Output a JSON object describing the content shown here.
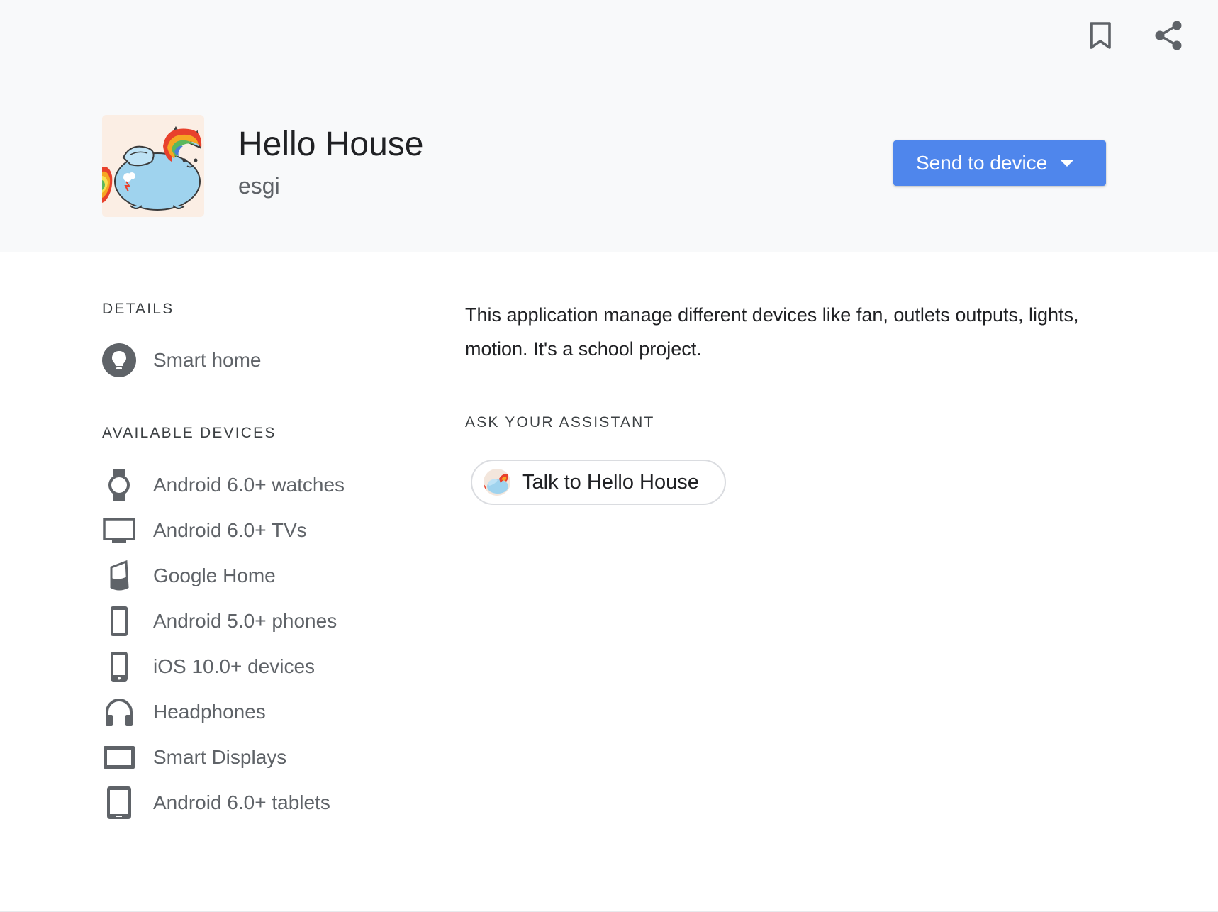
{
  "header": {
    "bookmark_icon": "bookmark-outline-icon",
    "share_icon": "share-icon",
    "app": {
      "title": "Hello House",
      "developer": "esgi",
      "icon": "rainbow-winged-cat-icon"
    },
    "send_button": {
      "label": "Send to device",
      "color": "#4f86ec",
      "icon": "caret-down-icon"
    }
  },
  "details": {
    "heading": "DETAILS",
    "category": {
      "icon": "lightbulb-icon",
      "label": "Smart home"
    }
  },
  "available_devices": {
    "heading": "AVAILABLE DEVICES",
    "items": [
      {
        "icon": "watch-icon",
        "label": "Android 6.0+ watches"
      },
      {
        "icon": "tv-icon",
        "label": "Android 6.0+ TVs"
      },
      {
        "icon": "google-home-icon",
        "label": "Google Home"
      },
      {
        "icon": "android-phone-icon",
        "label": "Android 5.0+ phones"
      },
      {
        "icon": "ios-phone-icon",
        "label": "iOS 10.0+ devices"
      },
      {
        "icon": "headphones-icon",
        "label": "Headphones"
      },
      {
        "icon": "smart-display-icon",
        "label": "Smart Displays"
      },
      {
        "icon": "tablet-icon",
        "label": "Android 6.0+ tablets"
      }
    ]
  },
  "main": {
    "description": "This application manage different devices like fan, outlets outputs, lights, motion. It's a school project.",
    "ask_heading": "ASK YOUR ASSISTANT",
    "talk_chip": {
      "label": "Talk to Hello House",
      "icon": "app-avatar-icon"
    }
  }
}
